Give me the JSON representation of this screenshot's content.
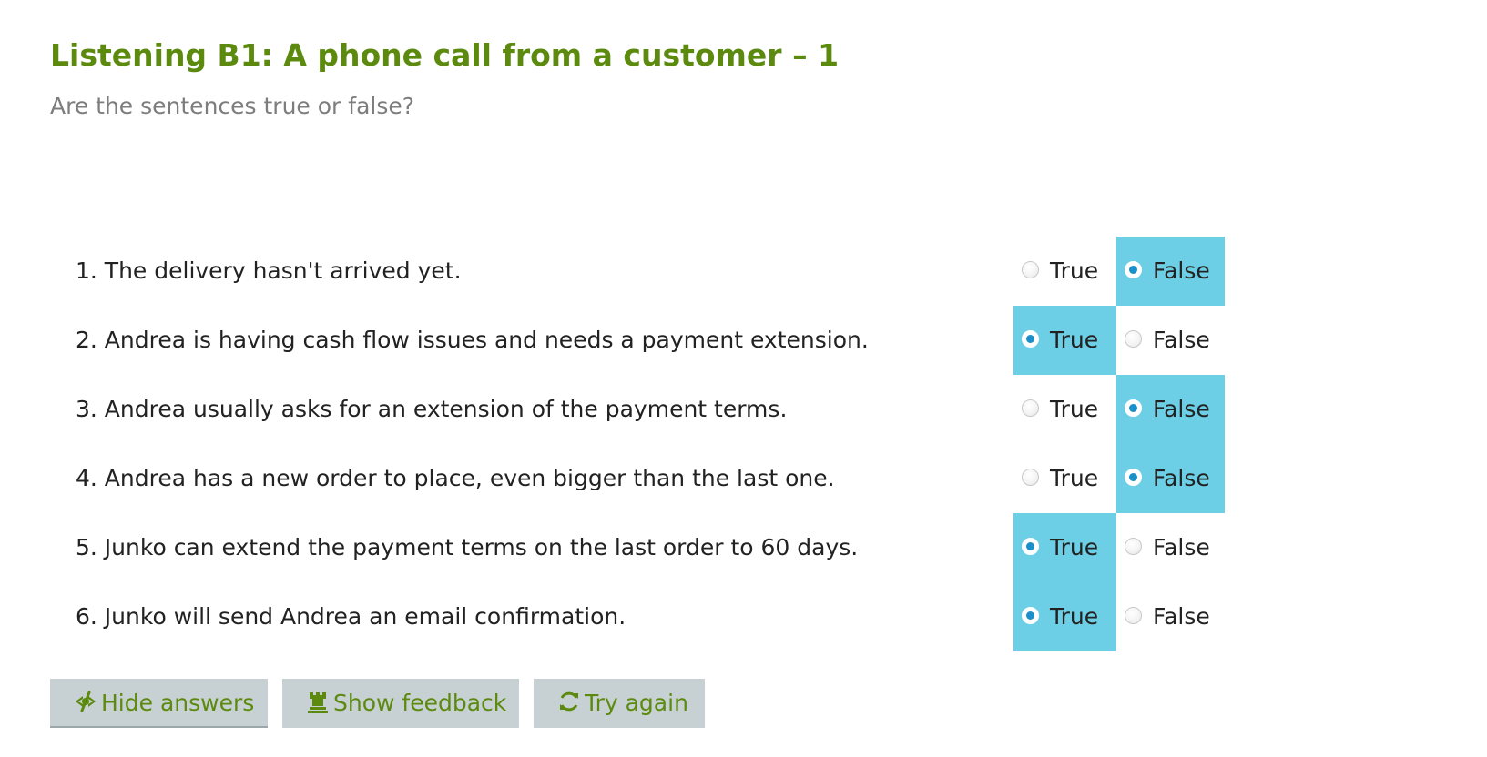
{
  "header": {
    "title": "Listening B1: A phone call from a customer – 1",
    "subtitle": "Are the sentences true or false?"
  },
  "options": {
    "true_label": "True",
    "false_label": "False"
  },
  "questions": [
    {
      "text": "1. The delivery hasn't arrived yet.",
      "selected": "False"
    },
    {
      "text": "2. Andrea is having cash flow issues and needs a payment extension.",
      "selected": "True"
    },
    {
      "text": "3. Andrea usually asks for an extension of the payment terms.",
      "selected": "False"
    },
    {
      "text": "4. Andrea has a new order to place, even bigger than the last one.",
      "selected": "False"
    },
    {
      "text": "5. Junko can extend the payment terms on the last order to 60 days.",
      "selected": "True"
    },
    {
      "text": "6. Junko will send Andrea an email confirmation.",
      "selected": "True"
    }
  ],
  "buttons": {
    "hide_answers": {
      "label": "Hide answers",
      "icon": "hide-eye-icon"
    },
    "show_feedback": {
      "label": "Show feedback",
      "icon": "rook-icon"
    },
    "try_again": {
      "label": "Try again",
      "icon": "refresh-icon"
    }
  },
  "colors": {
    "title": "#5c8a0f",
    "subtitle": "#7d7d7d",
    "selected_highlight": "#6ccfe6",
    "button_background": "#c7d0d3",
    "radio_selected_dot": "#1a8fc8"
  }
}
